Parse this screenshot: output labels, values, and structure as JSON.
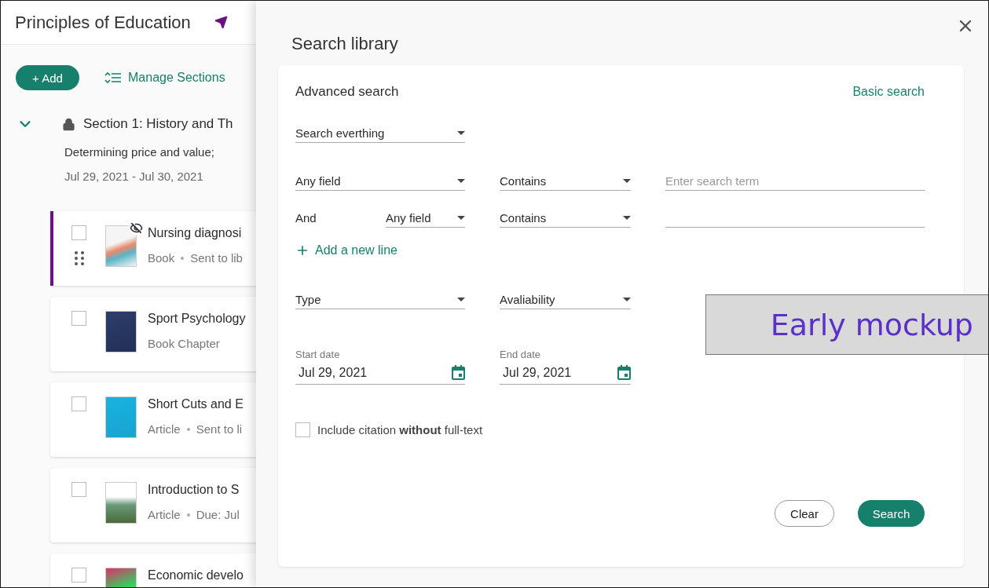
{
  "course": {
    "title": "Principles of Education"
  },
  "toolbar": {
    "add_button": "+ Add",
    "manage_sections": "Manage Sections"
  },
  "section": {
    "title": "Section 1: History and Th",
    "expanded": true,
    "locked": true,
    "description": "Determining price and value;",
    "dates": "Jul 29, 2021 - Jul 30, 2021"
  },
  "items": [
    {
      "title": "Nursing diagnosi",
      "meta": [
        "Book",
        "Sent to lib"
      ],
      "checked": false,
      "highlighted": true,
      "hidden": true
    },
    {
      "title": "Sport Psychology",
      "meta": [
        "Book Chapter"
      ],
      "checked": false,
      "highlighted": false,
      "hidden": false
    },
    {
      "title": "Short Cuts and E",
      "meta": [
        "Article",
        "Sent to li"
      ],
      "checked": false,
      "highlighted": false,
      "hidden": false
    },
    {
      "title": "Introduction to S",
      "meta": [
        "Article",
        "Due: Jul"
      ],
      "checked": false,
      "highlighted": false,
      "hidden": false
    },
    {
      "title": "Economic develo",
      "checked": false,
      "highlighted": false,
      "hidden": false
    }
  ],
  "drawer": {
    "title": "Search library",
    "mode_title": "Advanced search",
    "basic_link": "Basic search",
    "scope": "Search everthing",
    "rows": [
      {
        "field": "Any field",
        "operator": "Contains",
        "term_placeholder": "Enter search term"
      },
      {
        "connector": "And",
        "field": "Any field",
        "operator": "Contains"
      }
    ],
    "add_line": "Add a new line",
    "filters": [
      "Type",
      "Avaliability"
    ],
    "dates": [
      {
        "label": "Start date",
        "value": "Jul 29, 2021"
      },
      {
        "label": "End date",
        "value": "Jul 29, 2021"
      }
    ],
    "citation": {
      "text": "Include citation **without** full-text",
      "checked": false
    },
    "buttons": [
      {
        "label": "Clear",
        "kind": "secondary"
      },
      {
        "label": "Search",
        "kind": "primary"
      }
    ]
  },
  "overlay_label": "Early mockup"
}
